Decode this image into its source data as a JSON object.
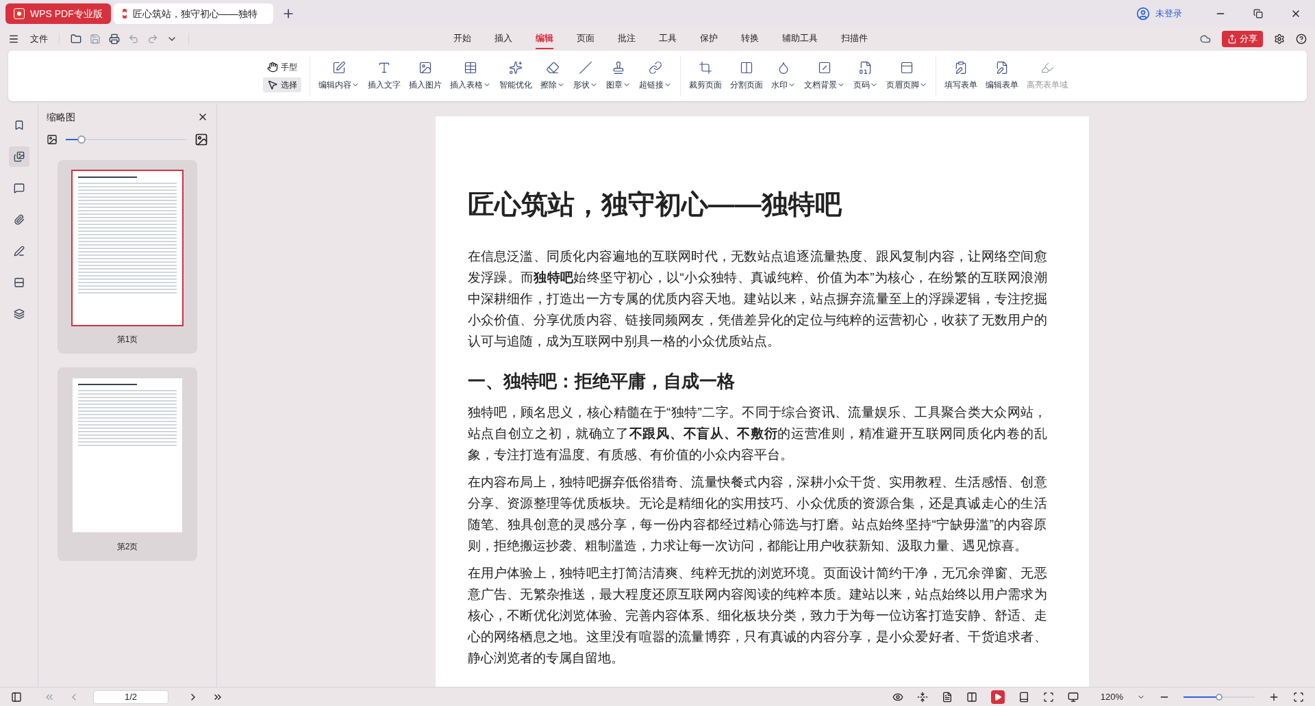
{
  "window": {
    "tabs": [
      {
        "label": "WPS PDF专业版",
        "kind": "app"
      },
      {
        "label": "匠心筑站，独守初心——独特",
        "kind": "document"
      }
    ],
    "account": "未登录"
  },
  "menu": {
    "file": "文件",
    "ribbon_tabs": [
      {
        "label": "开始",
        "selected": false
      },
      {
        "label": "插入",
        "selected": false
      },
      {
        "label": "编辑",
        "selected": true
      },
      {
        "label": "页面",
        "selected": false
      },
      {
        "label": "批注",
        "selected": false
      },
      {
        "label": "工具",
        "selected": false
      },
      {
        "label": "保护",
        "selected": false
      },
      {
        "label": "转换",
        "selected": false
      },
      {
        "label": "辅助工具",
        "selected": false
      },
      {
        "label": "扫描件",
        "selected": false
      }
    ],
    "share": "分享"
  },
  "toolbar": {
    "modes": [
      {
        "label": "手型",
        "selected": false
      },
      {
        "label": "选择",
        "selected": true
      }
    ],
    "groups": [
      [
        {
          "label": "编辑内容",
          "dropdown": true,
          "disabled": false
        },
        {
          "label": "插入文字",
          "dropdown": false,
          "disabled": false
        },
        {
          "label": "插入图片",
          "dropdown": false,
          "disabled": false
        },
        {
          "label": "插入表格",
          "dropdown": true,
          "disabled": false
        },
        {
          "label": "智能优化",
          "dropdown": false,
          "disabled": false
        },
        {
          "label": "擦除",
          "dropdown": true,
          "disabled": false
        },
        {
          "label": "形状",
          "dropdown": true,
          "disabled": false
        },
        {
          "label": "图章",
          "dropdown": true,
          "disabled": false
        },
        {
          "label": "超链接",
          "dropdown": true,
          "disabled": false
        }
      ],
      [
        {
          "label": "裁剪页面",
          "dropdown": false,
          "disabled": false
        },
        {
          "label": "分割页面",
          "dropdown": false,
          "disabled": false
        },
        {
          "label": "水印",
          "dropdown": true,
          "disabled": false
        },
        {
          "label": "文档背景",
          "dropdown": true,
          "disabled": false
        },
        {
          "label": "页码",
          "dropdown": true,
          "disabled": false
        },
        {
          "label": "页眉页脚",
          "dropdown": true,
          "disabled": false
        }
      ],
      [
        {
          "label": "填写表单",
          "dropdown": false,
          "disabled": false
        },
        {
          "label": "编辑表单",
          "dropdown": false,
          "disabled": false
        },
        {
          "label": "高亮表单域",
          "dropdown": false,
          "disabled": true
        }
      ]
    ]
  },
  "sidebar": {
    "title": "缩略图",
    "size": {
      "level": 0.13
    },
    "thumbnails": [
      {
        "label": "第1页",
        "selected": true
      },
      {
        "label": "第2页",
        "selected": false
      }
    ]
  },
  "document": {
    "title": "匠心筑站，独守初心——独特吧",
    "blocks": [
      {
        "kind": "paragraph",
        "text": "在信息泛滥、同质化内容遍地的互联网时代，无数站点追逐流量热度、跟风复制内容，让网络空间愈发浮躁。而**独特吧**始终坚守初心，以“小众独特、真诚纯粹、价值为本”为核心，在纷繁的互联网浪潮中深耕细作，打造出一方专属的优质内容天地。建站以来，站点摒弃流量至上的浮躁逻辑，专注挖掘小众价值、分享优质内容、链接同频网友，凭借差异化的定位与纯粹的运营初心，收获了无数用户的认可与追随，成为互联网中别具一格的小众优质站点。"
      },
      {
        "kind": "heading",
        "text": "一、独特吧：拒绝平庸，自成一格"
      },
      {
        "kind": "paragraph",
        "text": "独特吧，顾名思义，核心精髓在于“独特”二字。不同于综合资讯、流量娱乐、工具聚合类大众网站，站点自创立之初，就确立了**不跟风、不盲从、不敷衍**的运营准则，精准避开互联网同质化内卷的乱象，专注打造有温度、有质感、有价值的小众内容平台。"
      },
      {
        "kind": "paragraph",
        "text": "在内容布局上，独特吧摒弃低俗猎奇、流量快餐式内容，深耕小众干货、实用教程、生活感悟、创意分享、资源整理等优质板块。无论是精细化的实用技巧、小众优质的资源合集，还是真诚走心的生活随笔、独具创意的灵感分享，每一份内容都经过精心筛选与打磨。站点始终坚持“宁缺毋滥”的内容原则，拒绝搬运抄袭、粗制滥造，力求让每一次访问，都能让用户收获新知、汲取力量、遇见惊喜。"
      },
      {
        "kind": "paragraph",
        "text": "在用户体验上，独特吧主打简洁清爽、纯粹无扰的浏览环境。页面设计简约干净，无冗余弹窗、无恶意广告、无繁杂推送，最大程度还原互联网内容阅读的纯粹本质。建站以来，站点始终以用户需求为核心，不断优化浏览体验、完善内容体系、细化板块分类，致力于为每一位访客打造安静、舒适、走心的网络栖息之地。这里没有喧嚣的流量博弈，只有真诚的内容分享，是小众爱好者、干货追求者、静心浏览者的专属自留地。"
      }
    ]
  },
  "status_bar": {
    "page": "1/2",
    "zoom": "120%",
    "zoom_slider": {
      "level": 0.5
    }
  }
}
